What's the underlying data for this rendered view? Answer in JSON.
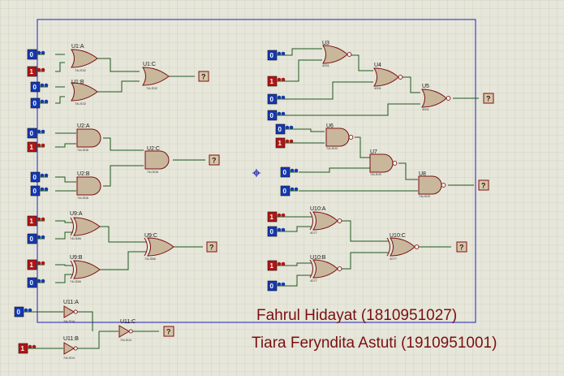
{
  "colors": {
    "background": "#e6e6da",
    "grid": "#cfcfbf",
    "frame": "#1c22b8",
    "wire": "#1e5a1e",
    "gate_fill": "#c9b79c",
    "gate_stroke": "#7a1010",
    "logic_low": "#1438b4",
    "logic_high": "#b41414",
    "probe_fill": "#d9c6a8",
    "author_text": "#7a1010"
  },
  "gate_labels": {
    "u1a": "U1:A",
    "u1b": "U1:B",
    "u1c": "U1:C",
    "u2a": "U2:A",
    "u2b": "U2:B",
    "u2c": "U2:C",
    "u9a": "U9:A",
    "u9b": "U9:B",
    "u9c": "U9:C",
    "u11a": "U11:A",
    "u11b": "U11:B",
    "u11c": "U11:C",
    "u3": "U3",
    "u4": "U4",
    "u5": "U5",
    "u6": "U6",
    "u7": "U7",
    "u8": "U8",
    "u10a": "U10:A",
    "u10b": "U10:B",
    "u10c": "U10:C"
  },
  "logic_values": {
    "in_1": "0",
    "in_2": "1",
    "in_3": "0",
    "in_4": "0",
    "in_5": "0",
    "in_6": "1",
    "in_7": "0",
    "in_8": "0",
    "in_9": "1",
    "in_10": "0",
    "in_11": "1",
    "in_12": "0",
    "in_13": "0",
    "in_14": "1",
    "in_15": "0",
    "in_16": "1",
    "in_17": "0",
    "in_18": "0",
    "in_19": "0",
    "in_20": "1",
    "in_21": "0",
    "in_22": "0",
    "in_23": "1",
    "in_24": "0",
    "in_25": "1",
    "in_26": "0"
  },
  "probe_text": "?",
  "authors": [
    "Fahrul Hidayat (1810951027)",
    "Tiara Feryndita Astuti (1910951001)"
  ]
}
